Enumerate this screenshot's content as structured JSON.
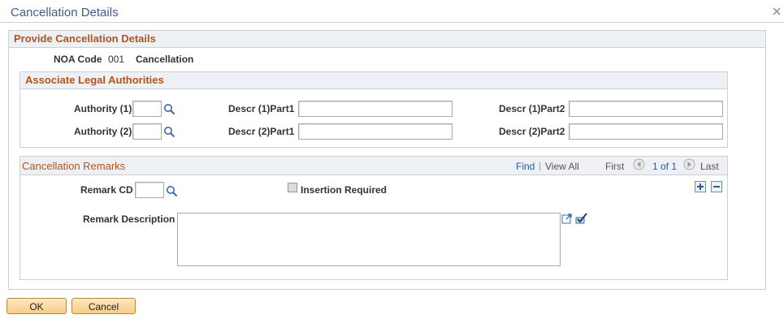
{
  "window": {
    "title": "Cancellation Details",
    "close_icon": "close-icon"
  },
  "main_section": {
    "title": "Provide Cancellation Details"
  },
  "noa": {
    "label": "NOA Code",
    "code": "001",
    "description": "Cancellation"
  },
  "legal": {
    "title": "Associate Legal Authorities",
    "rows": [
      {
        "authority_label": "Authority (1)",
        "authority_value": "",
        "descr_part1_label": "Descr (1)Part1",
        "descr_part1_value": "",
        "descr_part2_label": "Descr (1)Part2",
        "descr_part2_value": ""
      },
      {
        "authority_label": "Authority (2)",
        "authority_value": "",
        "descr_part1_label": "Descr (2)Part1",
        "descr_part1_value": "",
        "descr_part2_label": "Descr (2)Part2",
        "descr_part2_value": ""
      }
    ]
  },
  "remarks": {
    "title": "Cancellation Remarks",
    "find": "Find",
    "view_all": "View All",
    "first": "First",
    "page_info": "1 of 1",
    "last": "Last",
    "remark_cd_label": "Remark CD",
    "remark_cd_value": "",
    "insertion_label": "Insertion Required",
    "insertion_checked": false,
    "description_label": "Remark Description",
    "description_value": ""
  },
  "buttons": {
    "ok": "OK",
    "cancel": "Cancel"
  },
  "colors": {
    "section_title": "#b3541e",
    "link": "#2b5a97",
    "header_bg": "#edf1f5",
    "button_bg": "#f7cd86"
  }
}
